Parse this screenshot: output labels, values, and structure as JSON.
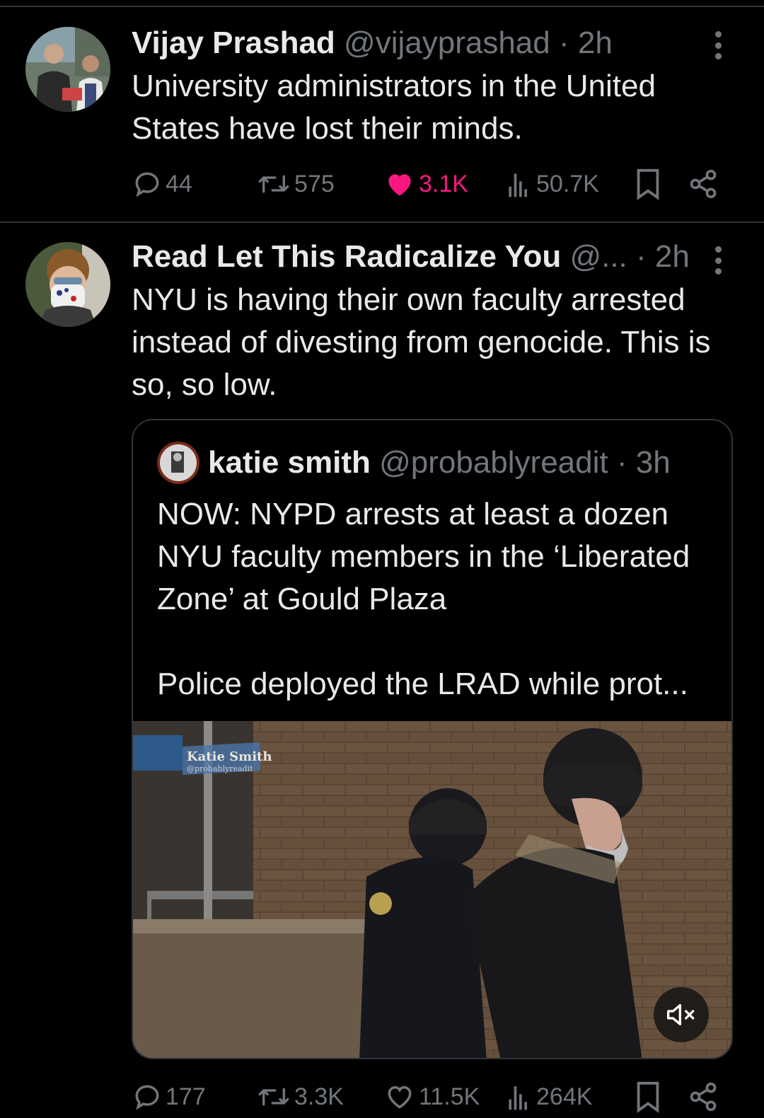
{
  "tweets": [
    {
      "author_name": "Vijay Prashad",
      "handle": "@vijayprashad",
      "separator": "·",
      "time": "2h",
      "text": "University administrators in the United States have lost their minds.",
      "stats": {
        "replies": "44",
        "reposts": "575",
        "likes": "3.1K",
        "views": "50.7K"
      },
      "liked": true
    },
    {
      "author_name": "Read Let This Radicalize You",
      "handle": "@...",
      "separator": "·",
      "time": "2h",
      "text": "NYU is having their own faculty arrested instead of divesting from genocide. This is so, so low.",
      "quoted": {
        "author_name": "katie smith",
        "handle": "@probablyreadit",
        "separator": "·",
        "time": "3h",
        "text_line1": "NOW: NYPD arrests at least a dozen NYU faculty members in the ‘Liberated Zone’ at Gould Plaza",
        "text_line2": "Police deployed the LRAD while prot...",
        "media": {
          "watermark_name": "Katie Smith",
          "watermark_handle": "@probablyreadit"
        }
      },
      "stats": {
        "replies": "177",
        "reposts": "3.3K",
        "likes": "11.5K",
        "views": "264K"
      },
      "liked": false
    }
  ],
  "icons": {
    "reply": "reply-icon",
    "repost": "repost-icon",
    "like": "heart-icon",
    "views": "views-chart-icon",
    "bookmark": "bookmark-icon",
    "share": "share-icon",
    "more": "more-vertical-icon",
    "mute": "muted-speaker-icon"
  },
  "colors": {
    "background": "#000000",
    "text": "#e7e9ea",
    "muted": "#71767b",
    "like": "#f91880",
    "border": "#2f3336"
  }
}
